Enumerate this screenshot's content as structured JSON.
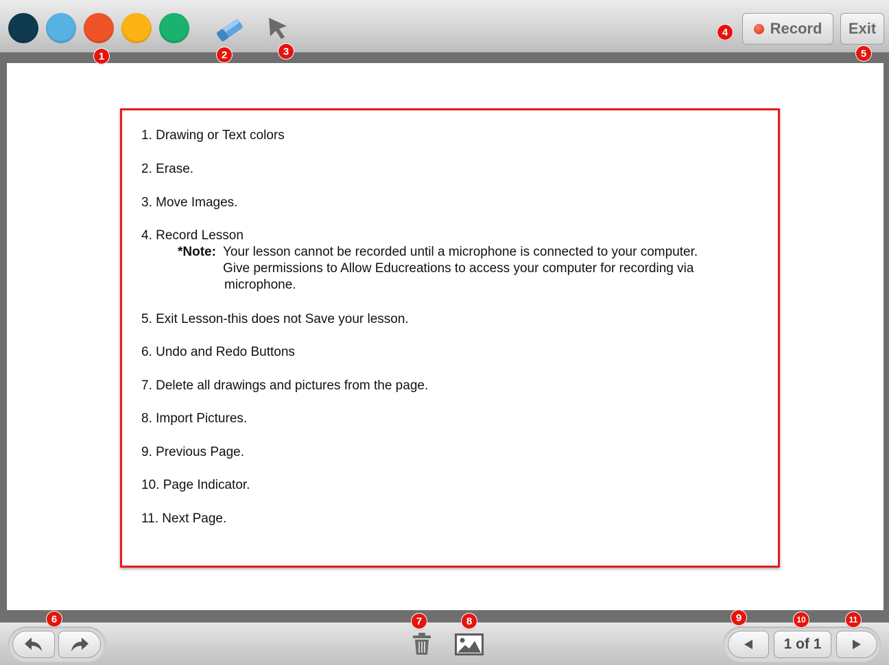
{
  "toolbar": {
    "colors": [
      "#0f3a50",
      "#58b1e3",
      "#ef5428",
      "#fcb316",
      "#1ab26c"
    ],
    "eraser_icon": "eraser-icon",
    "pointer_icon": "cursor-arrow-icon",
    "record_label": "Record",
    "exit_label": "Exit"
  },
  "badges": {
    "b1": "1",
    "b2": "2",
    "b3": "3",
    "b4": "4",
    "b5": "5",
    "b6": "6",
    "b7": "7",
    "b8": "8",
    "b9": "9",
    "b10": "10",
    "b11": "11"
  },
  "legend": {
    "items": [
      "1. Drawing or Text colors",
      "2. Erase.",
      "3. Move Images.",
      "4. Record Lesson",
      "5. Exit Lesson-this does not Save your lesson.",
      "6. Undo and Redo Buttons",
      "7. Delete all drawings and pictures from the page.",
      "8. Import Pictures.",
      "9. Previous Page.",
      "10. Page Indicator.",
      "11. Next Page."
    ],
    "note_label": "*Note:",
    "note_lines": [
      "Your lesson cannot be recorded until a microphone is connected to your computer.",
      "Give permissions to Allow Educreations to access your computer for recording via",
      "microphone."
    ]
  },
  "bottombar": {
    "undo_icon": "undo-arrow-icon",
    "redo_icon": "redo-arrow-icon",
    "trash_icon": "trash-icon",
    "image_icon": "image-icon",
    "prev_icon": "triangle-left-icon",
    "page_indicator": "1 of 1",
    "next_icon": "triangle-right-icon"
  },
  "colors": {
    "badge": "#e5140e",
    "highlight_border": "#e61b1b"
  }
}
